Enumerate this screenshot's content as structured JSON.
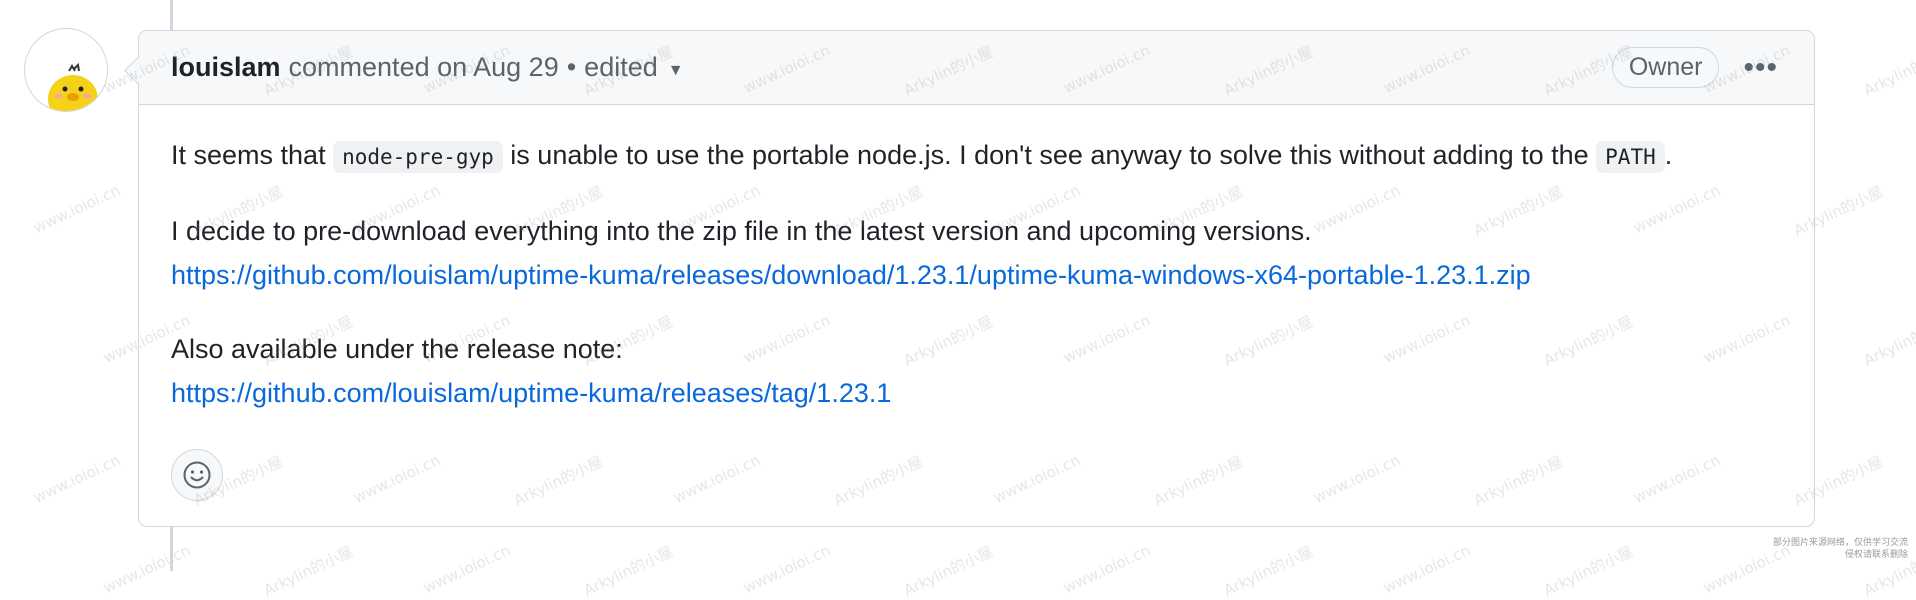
{
  "comment": {
    "author": "louislam",
    "meta": "commented on Aug 29",
    "separator": "•",
    "edited_label": "edited",
    "badge": "Owner",
    "menu_icon": "kebab-horizontal-icon",
    "paragraph1": {
      "text_before": "It seems that ",
      "code1": "node-pre-gyp",
      "text_middle": " is unable to use the portable node.js. I don't see anyway to solve this without adding to the ",
      "code2": "PATH",
      "text_after": "."
    },
    "paragraph2": {
      "text": "I decide to pre-download everything into the zip file in the latest version and upcoming versions.",
      "link": "https://github.com/louislam/uptime-kuma/releases/download/1.23.1/uptime-kuma-windows-x64-portable-1.23.1.zip"
    },
    "paragraph3": {
      "text": "Also available under the release note:",
      "link": "https://github.com/louislam/uptime-kuma/releases/tag/1.23.1"
    },
    "reaction_icon": "smiley-icon"
  },
  "watermarks": {
    "site": "www.ioioi.cn",
    "brand": "Arkylin的小屋"
  },
  "corner_note": {
    "line1": "部分图片来源网络，仅供学习交流",
    "line2": "侵权请联系删除"
  },
  "colors": {
    "link": "#0969da",
    "border": "#d0d7de",
    "header_bg": "#f6f8fa"
  }
}
